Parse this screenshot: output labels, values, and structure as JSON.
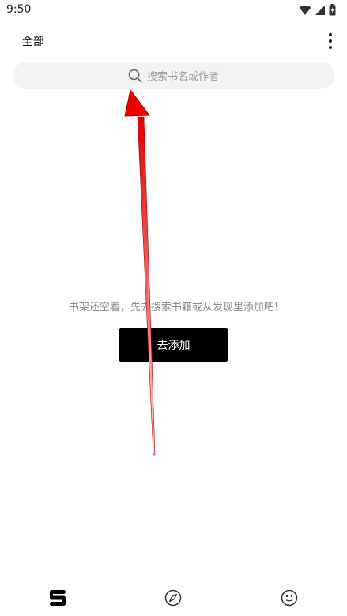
{
  "status_bar": {
    "time": "9:50",
    "icons": [
      "wifi-icon",
      "signal-icon",
      "battery-icon"
    ]
  },
  "header": {
    "title": "全部",
    "menu_icon": "more-vertical-icon"
  },
  "search": {
    "placeholder": "搜索书名或作者",
    "icon": "search-icon"
  },
  "empty_state": {
    "message": "书架还空着，先去搜索书籍或从发现里添加吧!",
    "button_label": "去添加"
  },
  "bottom_nav": {
    "items": [
      {
        "name": "bookshelf",
        "icon": "bookshelf-icon",
        "active": true
      },
      {
        "name": "discover",
        "icon": "compass-icon",
        "active": false
      },
      {
        "name": "profile",
        "icon": "smiley-face-icon",
        "active": false
      }
    ]
  },
  "colors": {
    "button_bg": "#000000",
    "search_bg": "#f3f3f3",
    "annotation_arrow": "#ff0000"
  }
}
